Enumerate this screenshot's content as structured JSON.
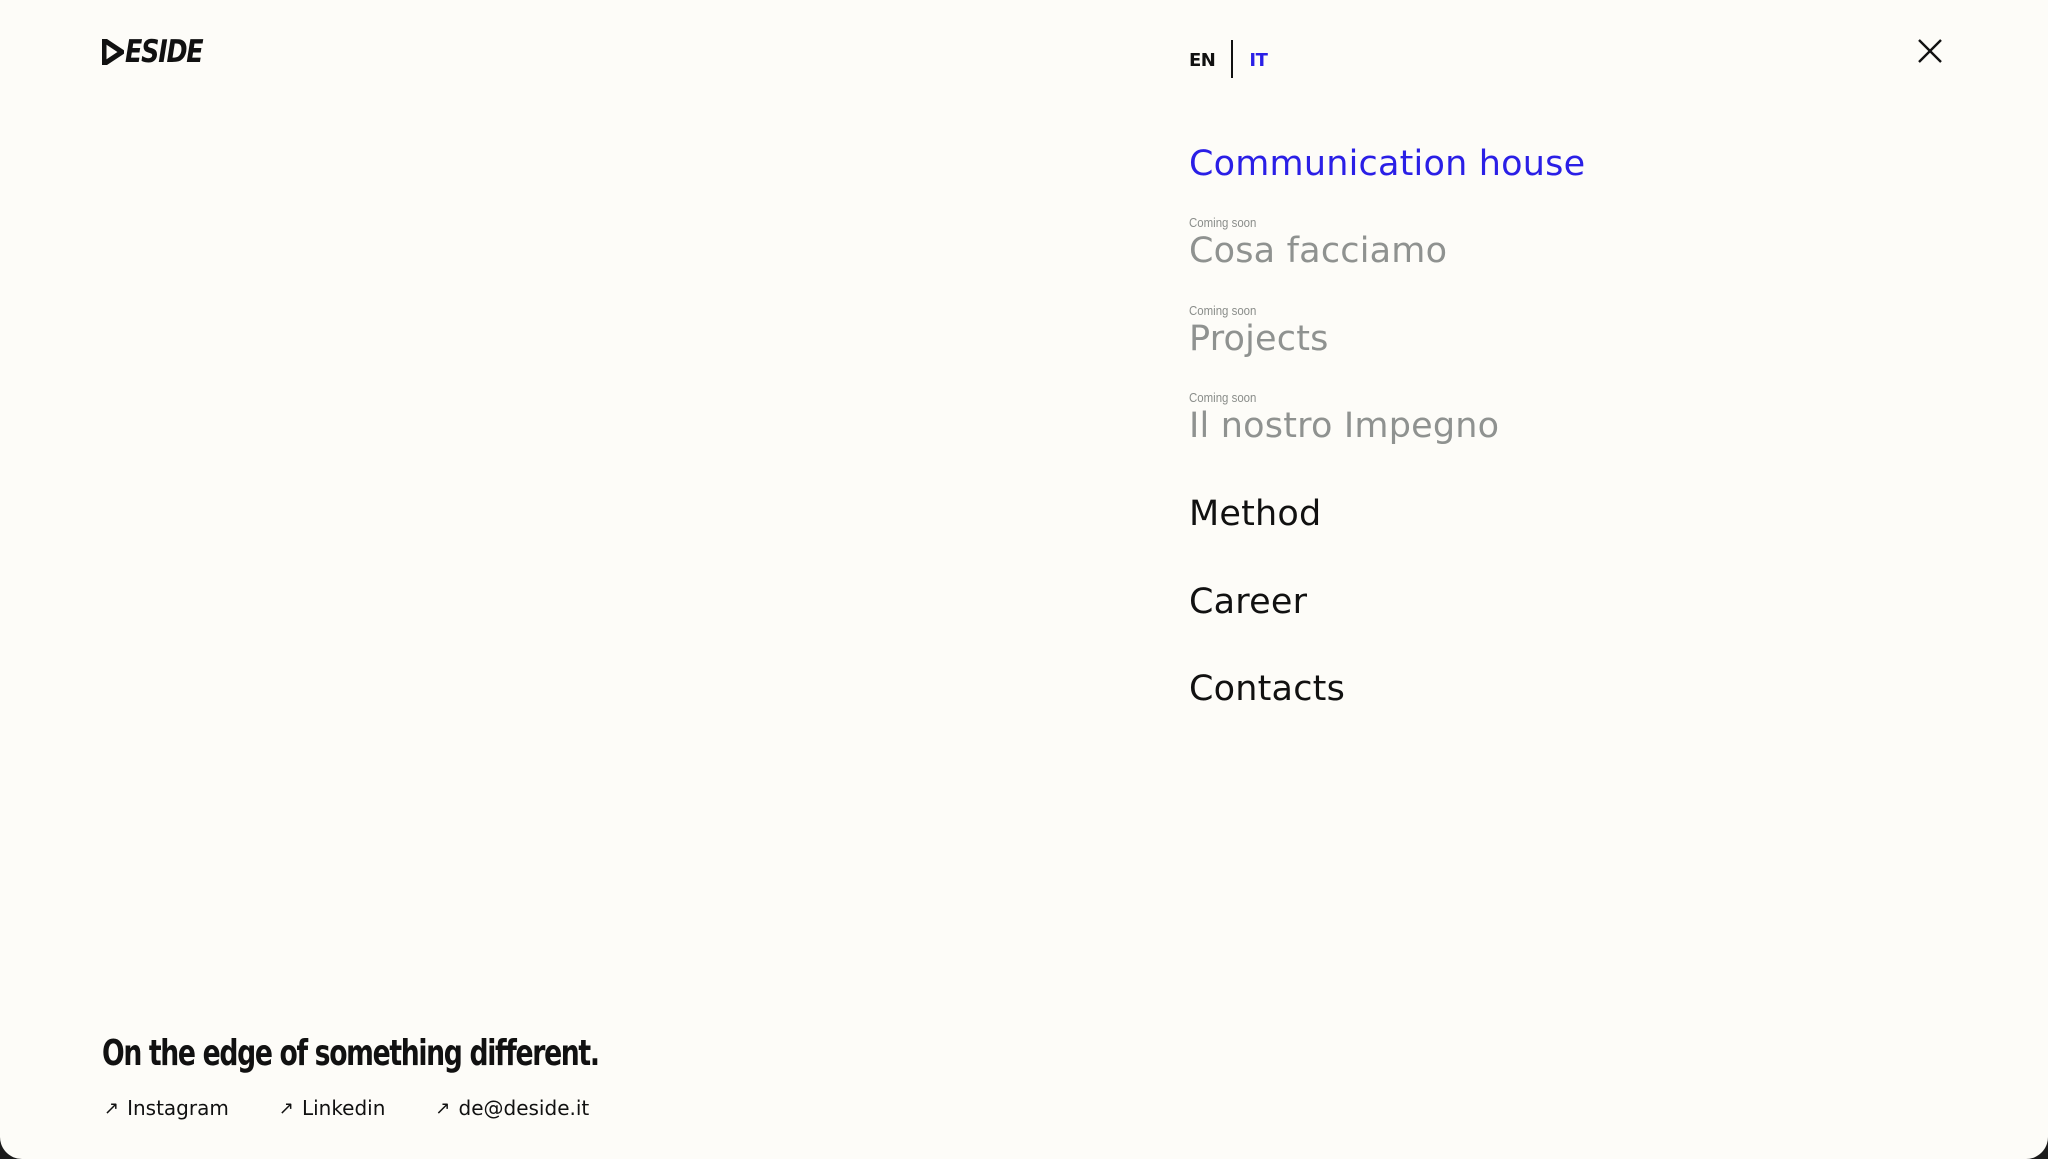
{
  "brand": {
    "logo_text": "ESIDE"
  },
  "language": {
    "options": [
      "EN",
      "IT"
    ],
    "selected": "IT"
  },
  "menu": {
    "items": [
      {
        "label": "Communication house",
        "state": "active",
        "note": ""
      },
      {
        "label": "Cosa facciamo",
        "state": "disabled",
        "note": "Coming soon"
      },
      {
        "label": "Projects",
        "state": "disabled",
        "note": "Coming soon"
      },
      {
        "label": "Il nostro Impegno",
        "state": "disabled",
        "note": "Coming soon"
      },
      {
        "label": "Method",
        "state": "normal",
        "note": ""
      },
      {
        "label": "Career",
        "state": "normal",
        "note": ""
      },
      {
        "label": "Contacts",
        "state": "normal",
        "note": ""
      }
    ]
  },
  "footer": {
    "tagline": "On the edge of something different.",
    "links": [
      {
        "label": "Instagram",
        "icon": "arrow-up-right-icon"
      },
      {
        "label": "Linkedin",
        "icon": "arrow-up-right-icon"
      },
      {
        "label": "de@deside.it",
        "icon": "arrow-up-right-icon"
      }
    ]
  },
  "colors": {
    "background": "#fdfcf8",
    "accent": "#2a1fe6",
    "text": "#111111",
    "muted": "#8f9290"
  }
}
